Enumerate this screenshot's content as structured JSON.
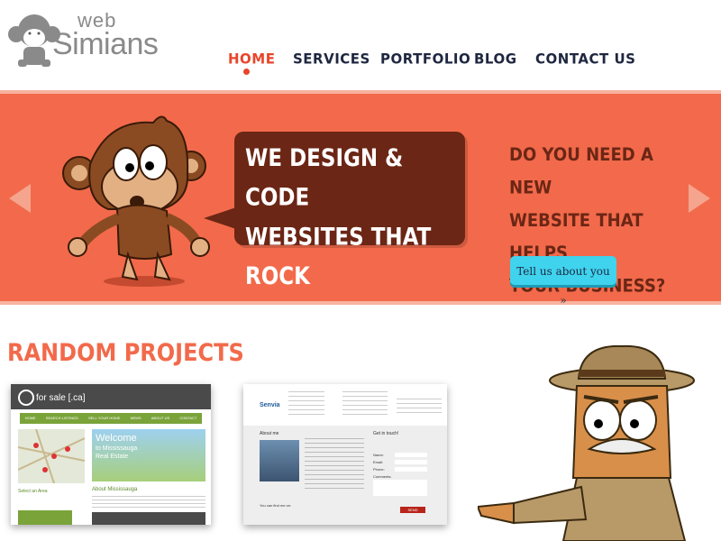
{
  "logo": {
    "web": "web",
    "simians": "Simians"
  },
  "nav": {
    "items": [
      {
        "label": "HOME",
        "active": true
      },
      {
        "label": "SERVICES",
        "active": false
      },
      {
        "label": "PORTFOLIO",
        "active": false
      },
      {
        "label": "BLOG",
        "active": false
      },
      {
        "label": "CONTACT US",
        "active": false
      }
    ]
  },
  "hero": {
    "headline_line1": "WE DESIGN & CODE",
    "headline_line2": "WEBSITES THAT ROCK",
    "question_line1": "DO YOU NEED A NEW",
    "question_line2": "WEBSITE THAT HELPS",
    "question_line3": "YOUR BUSINESS?",
    "cta_label": "Tell us about you »"
  },
  "projects": {
    "title": "RANDOM PROJECTS",
    "thumb1": {
      "brand": "for sale [.ca]",
      "nav": [
        "HOME",
        "SEARCH LISTINGS",
        "SELL YOUR HOME",
        "NEWS",
        "ABOUT US",
        "CONTACT"
      ],
      "welcome_line1": "Welcome",
      "welcome_line2": "to Mississauga",
      "welcome_line3": "Real Estate",
      "about_title": "About Mississauga",
      "select_area": "Select an Area"
    },
    "thumb2": {
      "brand": "Senvia",
      "about_me": "About me",
      "get_in_touch": "Get in touch!",
      "fields": [
        "Name:",
        "Email:",
        "Phone:",
        "Comments:"
      ],
      "send": "SEND",
      "find_me": "You can find me on:"
    }
  },
  "colors": {
    "accent": "#f26a4b",
    "dark_brown": "#6b2615",
    "navy": "#1f2740",
    "cta": "#3fd3ee",
    "active_nav": "#e8452b"
  }
}
